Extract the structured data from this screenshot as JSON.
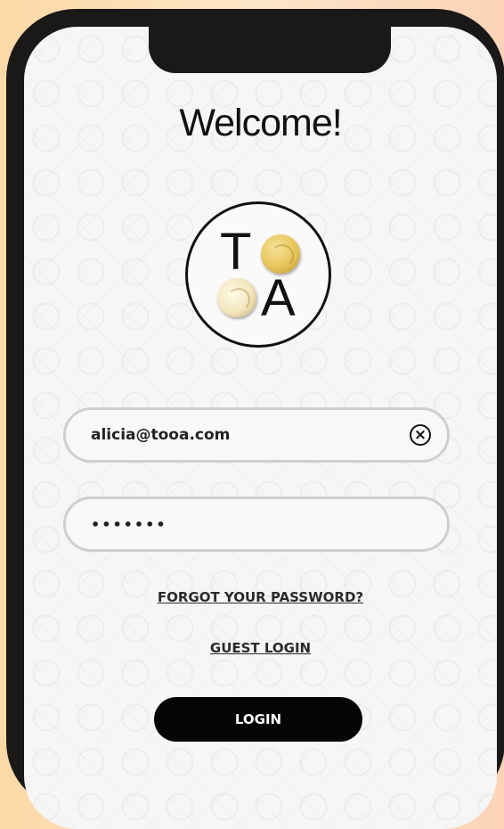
{
  "screen": {
    "title": "Welcome!",
    "logo": {
      "letter_top": "T",
      "letter_bottom": "A"
    }
  },
  "login_form": {
    "email": {
      "value": "alicia@tooa.com",
      "clear_icon": "clear-circle-x"
    },
    "password": {
      "value": "•••••••"
    },
    "forgot_link": "FORGOT YOUR PASSWORD?",
    "guest_link": "GUEST LOGIN",
    "login_button": "LOGIN"
  },
  "colors": {
    "background_left": "#fcd9a6",
    "background_right": "#fcd3b8",
    "phone_frame": "#1b1818",
    "screen_bg": "#f6f6f6",
    "button_bg": "#050505",
    "field_border": "#cfcfcf"
  }
}
